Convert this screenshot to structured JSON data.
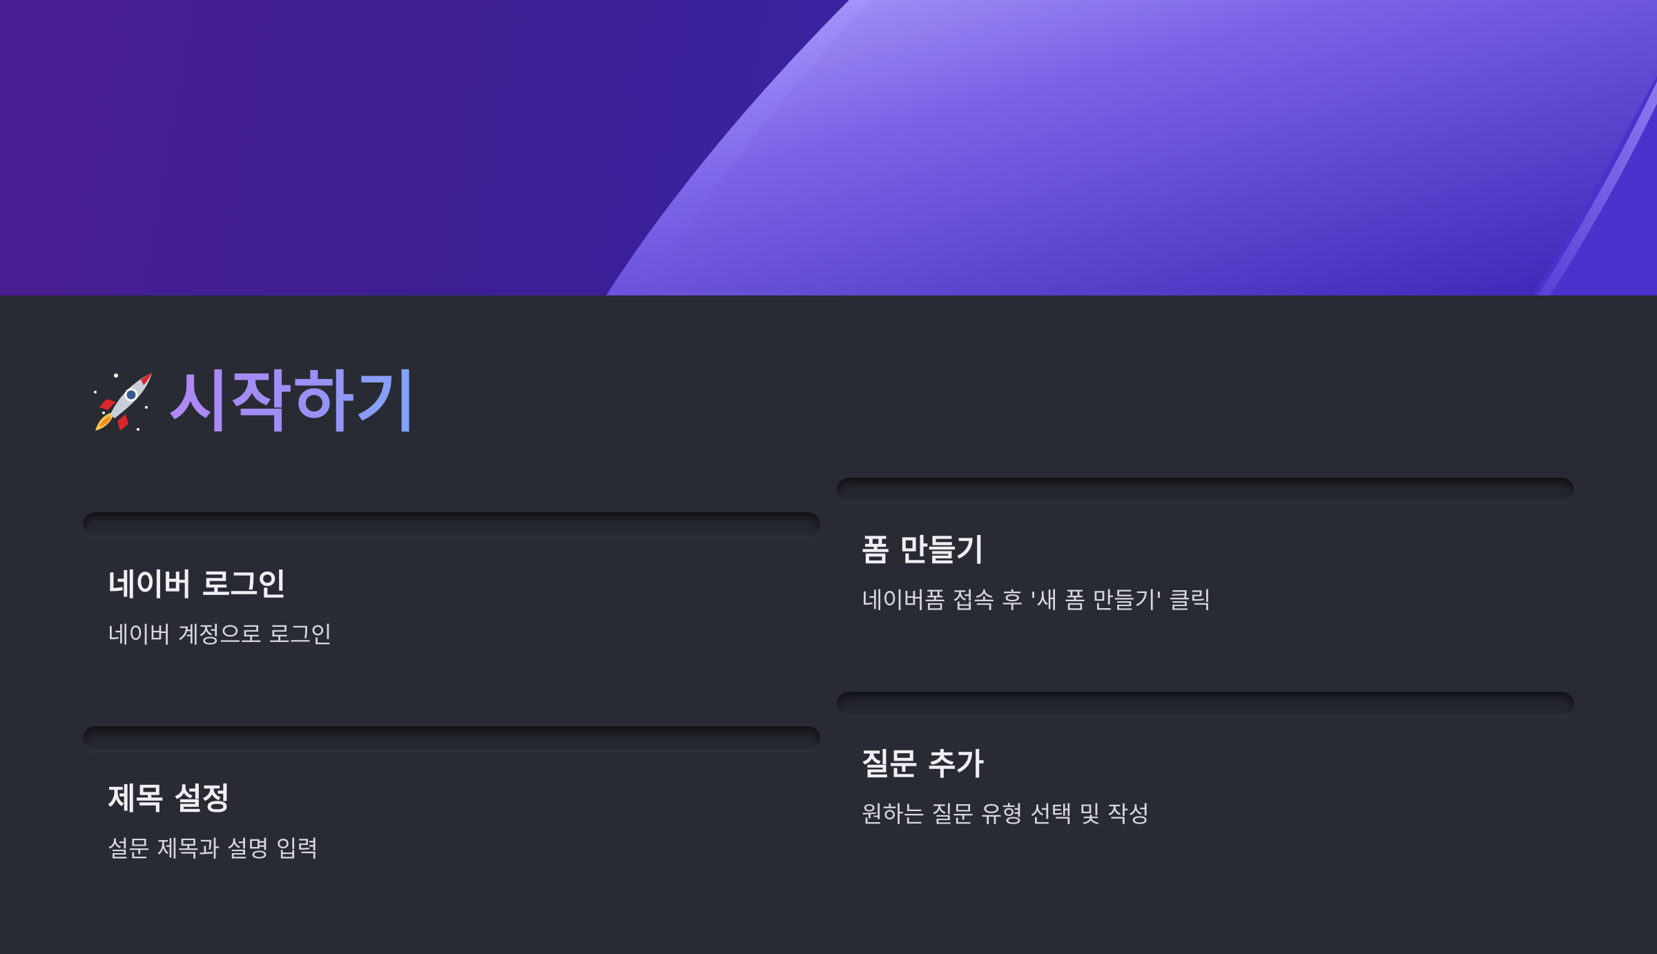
{
  "header": {
    "title_icon": "rocket-icon",
    "title": "시작하기",
    "title_gradient": [
      "#b088f5",
      "#7fa6f7"
    ]
  },
  "steps": [
    {
      "title": "네이버 로그인",
      "description": "네이버 계정으로 로그인"
    },
    {
      "title": "폼 만들기",
      "description": "네이버폼 접속 후 '새 폼 만들기' 클릭"
    },
    {
      "title": "제목 설정",
      "description": "설문 제목과 설명 입력"
    },
    {
      "title": "질문 추가",
      "description": "원하는 질문 유형 선택 및 작성"
    }
  ],
  "colors": {
    "hero_purple": "#3c1f93",
    "hero_highlight": "#a08cf5",
    "background": "#282b33"
  }
}
